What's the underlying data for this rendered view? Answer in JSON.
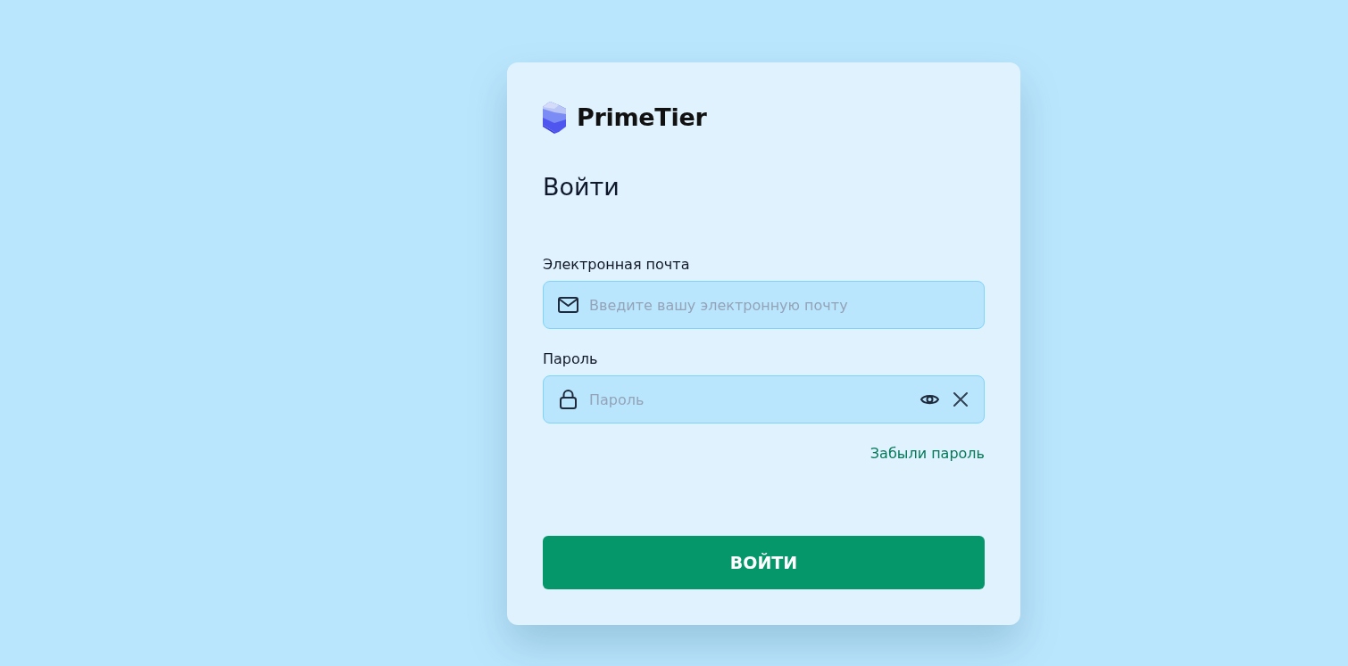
{
  "logo": {
    "name": "PrimeTier"
  },
  "title": "Войти",
  "fields": [
    {
      "kind": "email",
      "label": "Электронная почта",
      "placeholder": "Введите вашу электронную почту"
    },
    {
      "kind": "password",
      "label": "Пароль",
      "placeholder": "Пароль"
    }
  ],
  "forgot_link": "Забыли пароль",
  "submit_button": "ВОЙТИ"
}
